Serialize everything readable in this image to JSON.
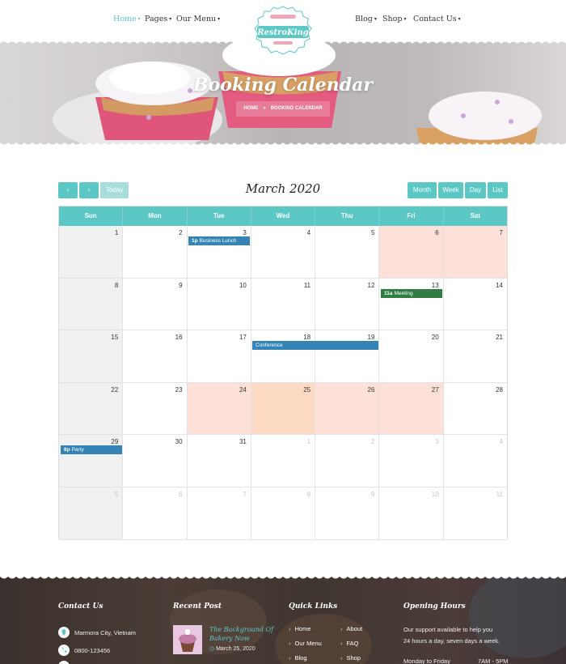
{
  "nav": {
    "home": "Home",
    "pages": "Pages",
    "our_menu": "Our Menu",
    "blog": "Blog",
    "shop": "Shop",
    "contact": "Contact Us"
  },
  "logo": {
    "name": "RestroKing"
  },
  "hero": {
    "title": "Booking Calendar",
    "breadcrumb_home": "HOME",
    "breadcrumb_sep": "»",
    "breadcrumb_current": "BOOKING CALENDAR"
  },
  "toolbar": {
    "prev_icon": "chevron-left",
    "next_icon": "chevron-right",
    "today": "Today",
    "title": "March 2020",
    "month": "Month",
    "week": "Week",
    "day": "Day",
    "list": "List"
  },
  "calendar": {
    "weekdays": [
      "Sun",
      "Mon",
      "Tue",
      "Wed",
      "Thu",
      "Fri",
      "Sat"
    ],
    "weeks": [
      [
        "1",
        "2",
        "3",
        "4",
        "5",
        "6",
        "7"
      ],
      [
        "8",
        "9",
        "10",
        "11",
        "12",
        "13",
        "14"
      ],
      [
        "15",
        "16",
        "17",
        "18",
        "19",
        "20",
        "21"
      ],
      [
        "22",
        "23",
        "24",
        "25",
        "26",
        "27",
        "28"
      ],
      [
        "29",
        "30",
        "31",
        "1",
        "2",
        "3",
        "4"
      ],
      [
        "5",
        "6",
        "7",
        "8",
        "9",
        "10",
        "11"
      ]
    ],
    "events": {
      "business_lunch": {
        "time": "1p",
        "title": "Business Lunch"
      },
      "meeting": {
        "time": "11a",
        "title": "Meeting"
      },
      "conference": {
        "title": "Conference"
      },
      "party": {
        "time": "8p",
        "title": "Party"
      }
    },
    "colors": {
      "accent": "#5bc8c6",
      "event_blue": "#3485b5",
      "event_green": "#2f7d42",
      "highlight": "#fde0d8"
    }
  },
  "footer": {
    "contact_title": "Contact Us",
    "address": "Marmora City, Vietnam",
    "phone": "0800-123456",
    "recent_title": "Recent Post",
    "post_title_line1": "The Background Of",
    "post_title_line2": "Bakery Now",
    "post_date": "March 25, 2020",
    "quick_title": "Quick Links",
    "links": [
      "Home",
      "Our Menu",
      "Blog",
      "About",
      "FAQ",
      "Shop"
    ],
    "hours_title": "Opening Hours",
    "hours_text_1": "Our support available to help you",
    "hours_text_2": "24 hours a day, seven days a week.",
    "hours_day": "Monday to Friday",
    "hours_time": "7AM - 5PM"
  }
}
